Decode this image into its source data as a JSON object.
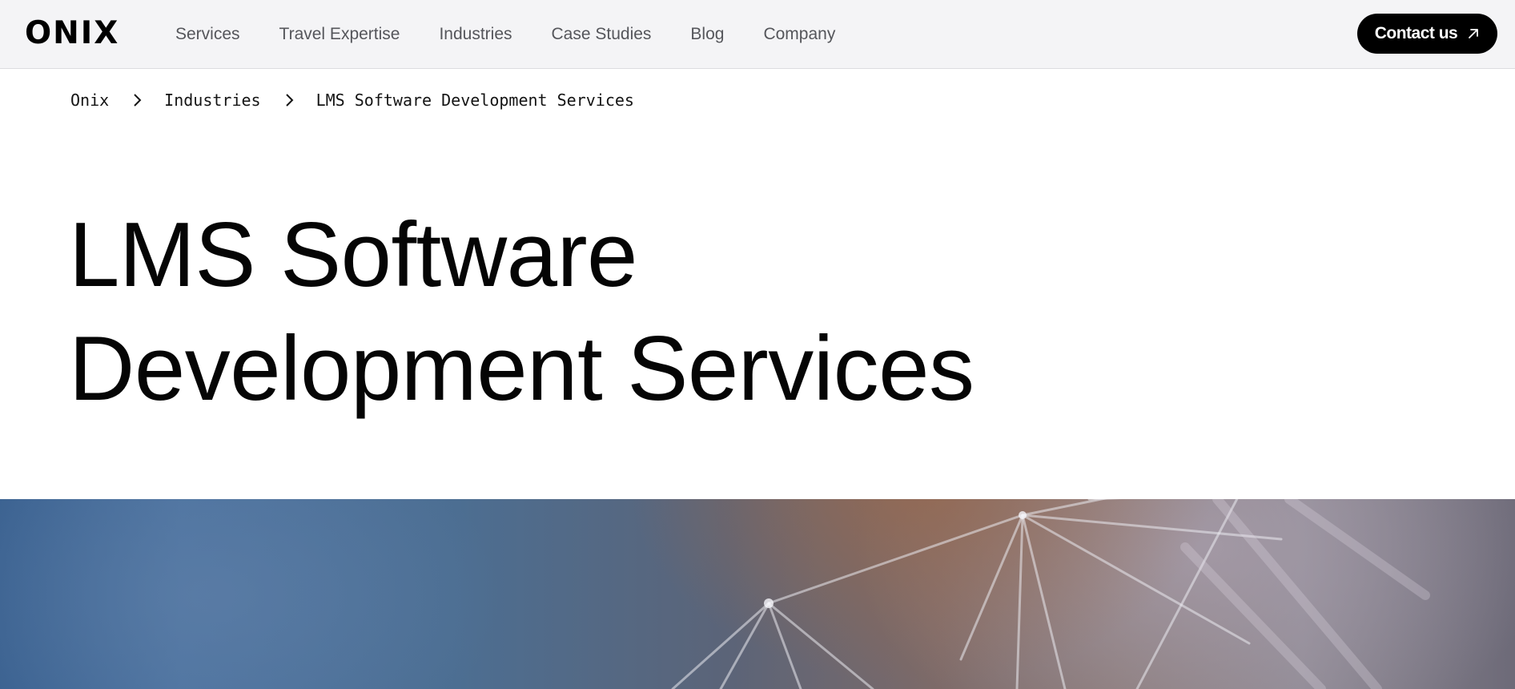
{
  "header": {
    "logo_text": "ONIX",
    "nav": [
      {
        "label": "Services"
      },
      {
        "label": "Travel Expertise"
      },
      {
        "label": "Industries"
      },
      {
        "label": "Case Studies"
      },
      {
        "label": "Blog"
      },
      {
        "label": "Company"
      }
    ],
    "contact_label": "Contact us",
    "contact_icon": "arrow-up-right-icon"
  },
  "breadcrumb": {
    "items": [
      {
        "label": "Onix"
      },
      {
        "label": "Industries"
      },
      {
        "label": "LMS Software Development Services"
      }
    ],
    "separator_icon": "chevron-right-icon"
  },
  "hero": {
    "title_line_1": "LMS Software",
    "title_line_2": "Development Services"
  },
  "colors": {
    "header_bg": "#f4f4f6",
    "nav_text": "#55565b",
    "button_bg": "#000000",
    "button_text": "#ffffff",
    "title_text": "#050505"
  }
}
